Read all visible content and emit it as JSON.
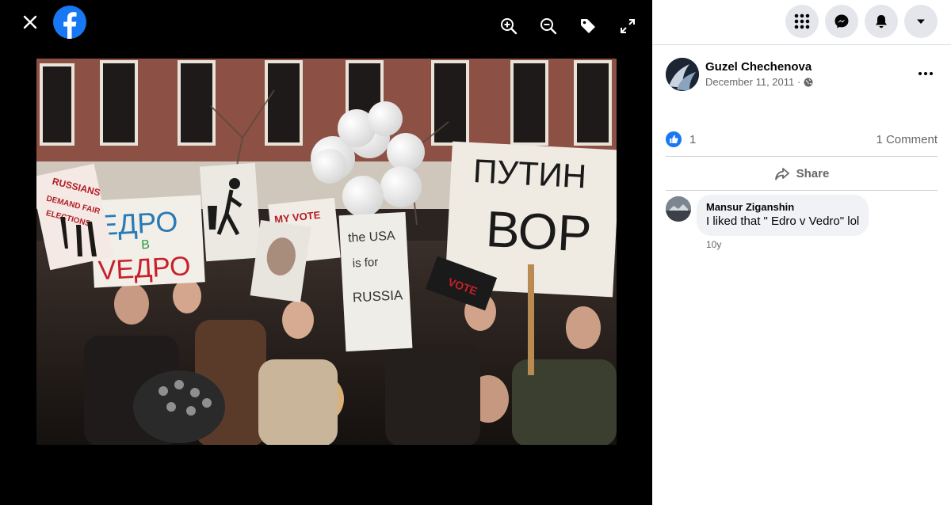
{
  "viewer": {
    "close_icon": "close-icon",
    "logo_icon": "facebook-logo-icon",
    "tools": [
      "zoom-in-icon",
      "zoom-out-icon",
      "tag-icon",
      "fullscreen-icon"
    ]
  },
  "photo": {
    "signs": {
      "putin_line1": "ПУТИН",
      "putin_line2": "ВОР",
      "edro_line1": "ЕДРО",
      "edro_line2": "В",
      "edro_line3": "VЕДРО",
      "russians_line1": "RUSSIANS",
      "russians_line2": "DEMAND FAIR",
      "russians_line3": "ELECTIONS",
      "my_vote": "MY VOTE",
      "usa_line1": "the USA",
      "usa_line2": "is for",
      "usa_line3": "RUSSIA",
      "vote_small": "VOTE"
    }
  },
  "topbar": {
    "buttons": [
      "menu-grid-icon",
      "messenger-icon",
      "notifications-bell-icon",
      "account-chevron-icon"
    ]
  },
  "post": {
    "author": "Guzel Chechenova",
    "date": "December 11, 2011 ·",
    "like_count": "1",
    "comment_count": "1 Comment",
    "share_label": "Share"
  },
  "comments": [
    {
      "author": "Mansur Ziganshin",
      "text": "I liked that \" Edro v Vedro\" lol",
      "time": "10y"
    }
  ],
  "colors": {
    "facebook_blue": "#1877f2",
    "panel_button_gray": "#e4e6eb",
    "secondary_text": "#65676b"
  }
}
